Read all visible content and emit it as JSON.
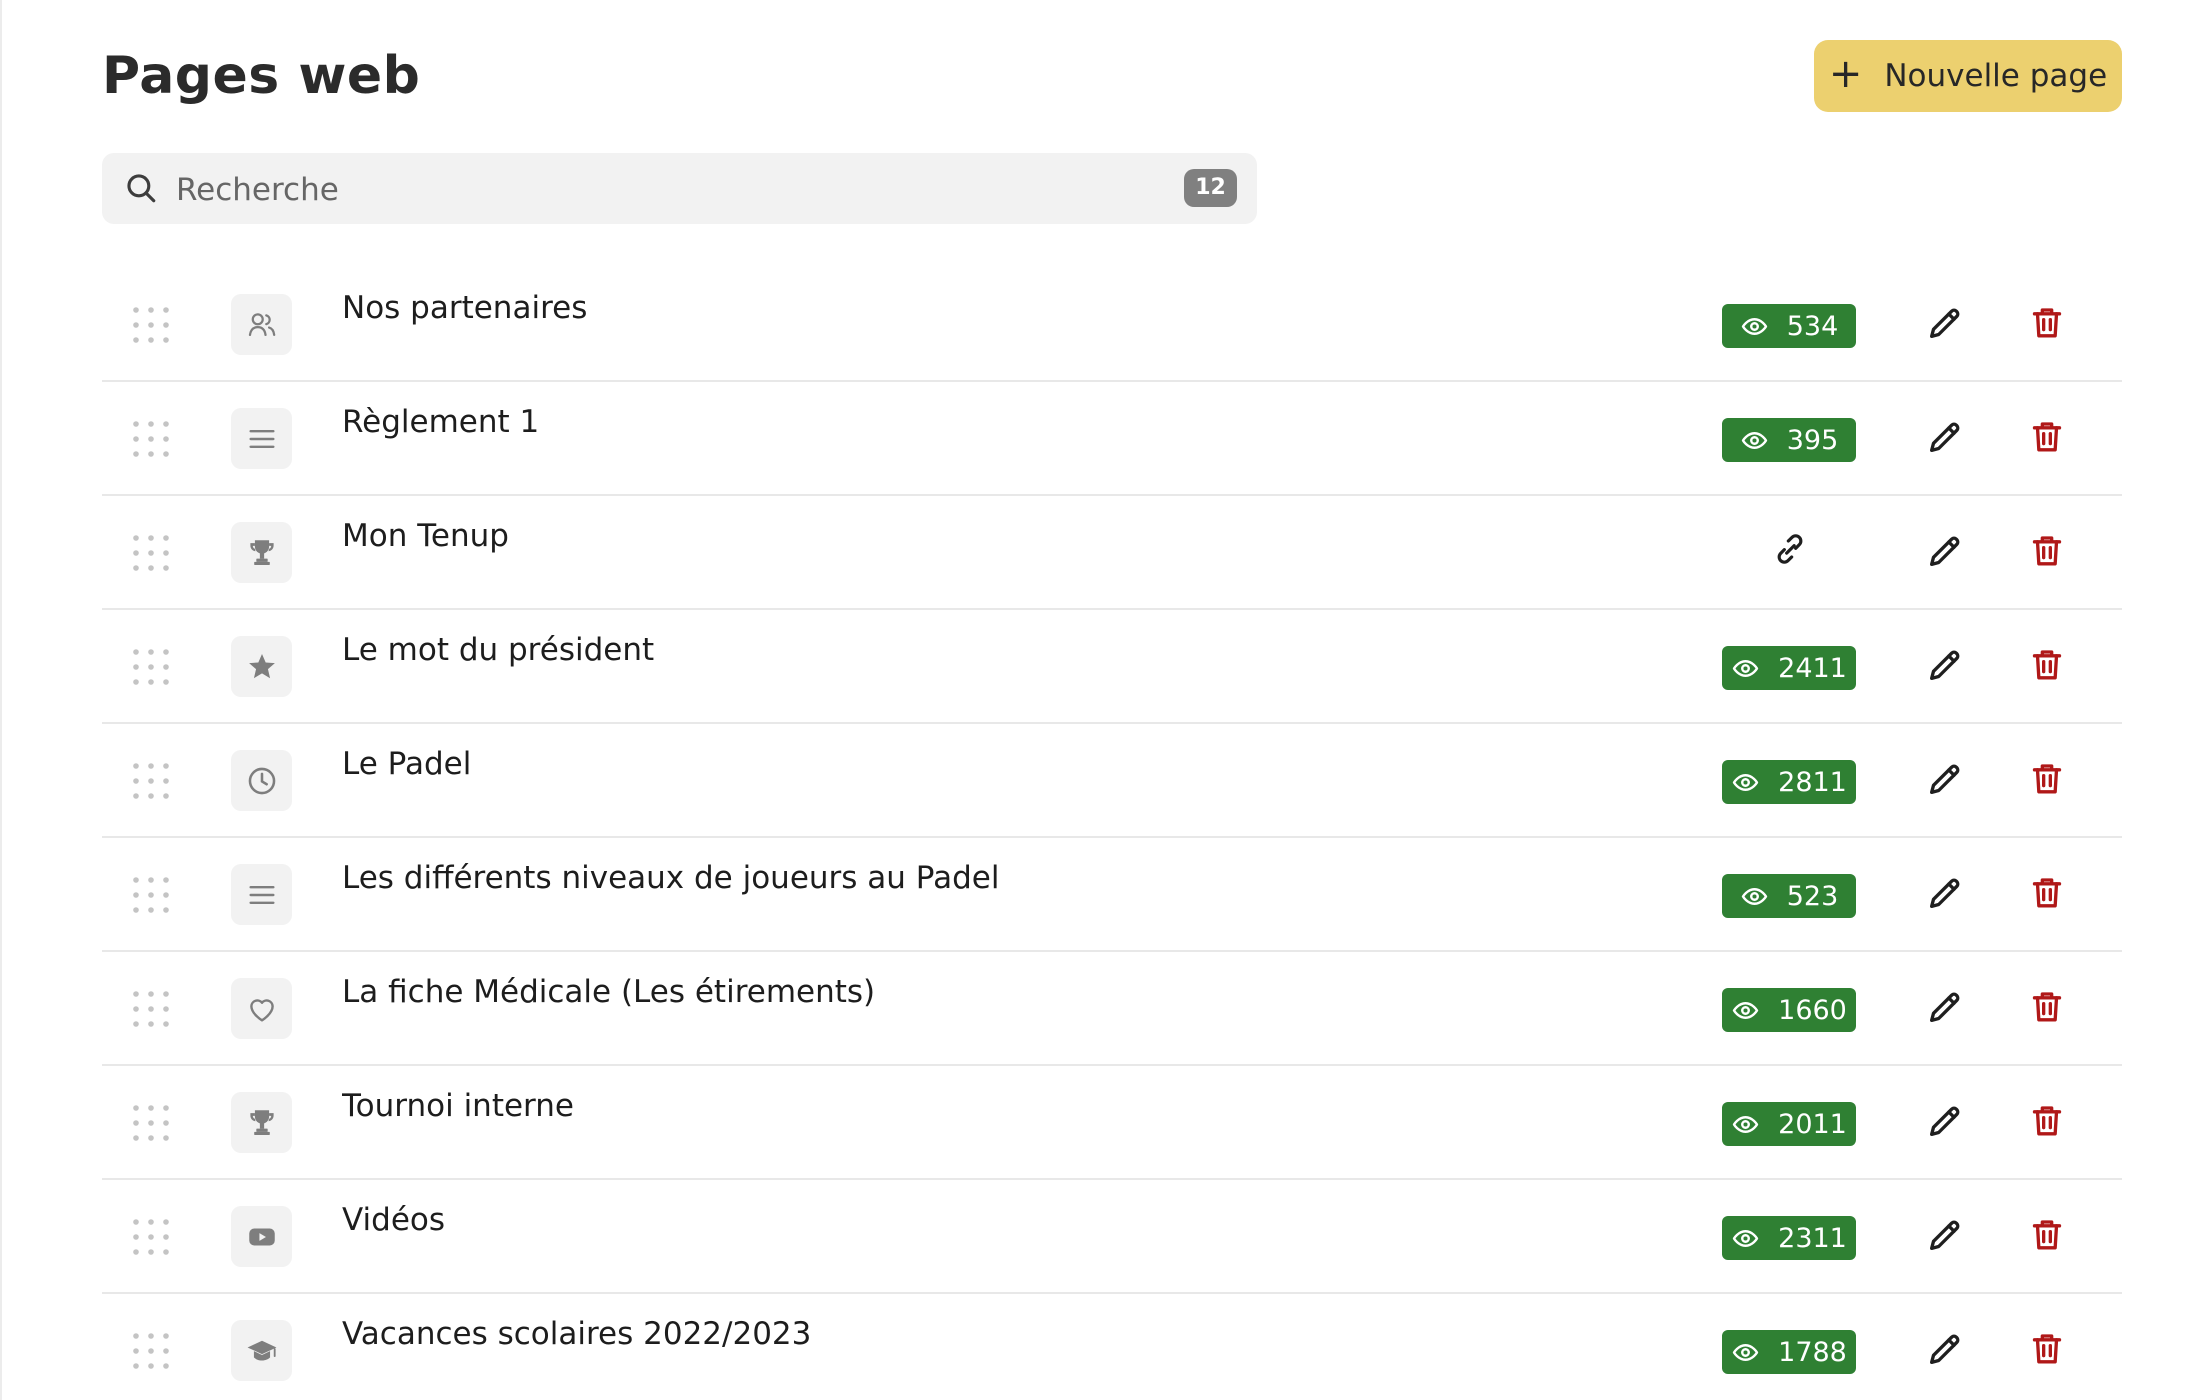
{
  "header": {
    "title": "Pages web",
    "new_page_button": {
      "plus_icon": "+",
      "label": "Nouvelle page"
    }
  },
  "search": {
    "placeholder": "Recherche",
    "value": "",
    "count": "12"
  },
  "pages": [
    {
      "name": "Nos partenaires",
      "icon": "users-icon",
      "action": "views",
      "views": "534"
    },
    {
      "name": "Règlement 1",
      "icon": "lines-icon",
      "action": "views",
      "views": "395"
    },
    {
      "name": "Mon Tenup",
      "icon": "trophy-icon",
      "action": "link",
      "views": ""
    },
    {
      "name": "Le mot du président",
      "icon": "star-icon",
      "action": "views",
      "views": "2411"
    },
    {
      "name": "Le Padel",
      "icon": "clock-icon",
      "action": "views",
      "views": "2811"
    },
    {
      "name": "Les différents niveaux de joueurs au Padel",
      "icon": "lines-icon",
      "action": "views",
      "views": "523"
    },
    {
      "name": "La fiche Médicale (Les étirements)",
      "icon": "heart-icon",
      "action": "views",
      "views": "1660"
    },
    {
      "name": "Tournoi interne",
      "icon": "trophy-icon",
      "action": "views",
      "views": "2011"
    },
    {
      "name": "Vidéos",
      "icon": "youtube-icon",
      "action": "views",
      "views": "2311"
    },
    {
      "name": "Vacances scolaires 2022/2023",
      "icon": "graduation-cap-icon",
      "action": "views",
      "views": "1788"
    }
  ],
  "colors": {
    "primary_button": "#ecd06f",
    "views_badge": "#2f8033",
    "delete_icon": "#b01818",
    "muted_icon": "#7e7e7e",
    "count_badge": "#808080"
  }
}
